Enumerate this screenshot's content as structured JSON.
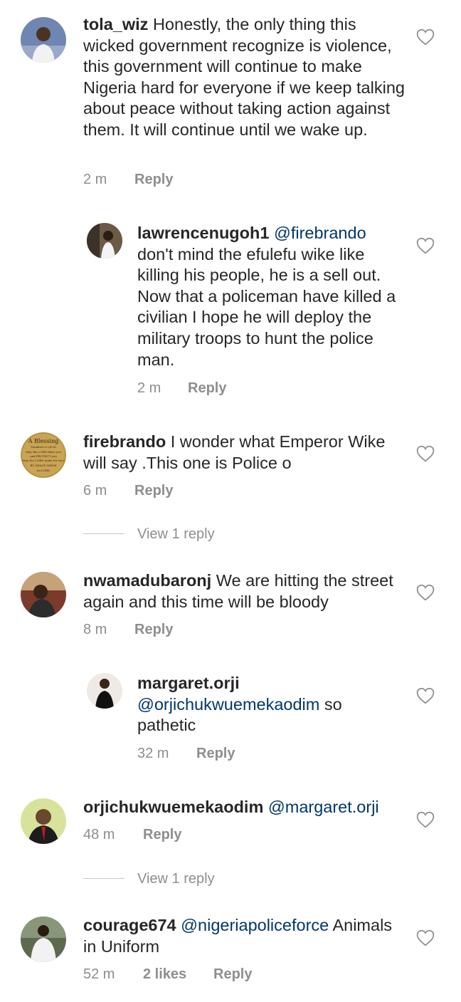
{
  "comments": [
    {
      "user": "tola_wiz",
      "text": "Honestly, the only thing this wicked government recognize is violence, this government will continue to make Nigeria hard for everyone if we keep talking about peace without taking action against them. It will continue until we wake up.",
      "time": "2 m",
      "reply_label": "Reply"
    },
    {
      "user": "lawrencenugoh1",
      "mention": "@firebrando",
      "text": "don't mind the efulefu wike like killing his people, he is a sell out. Now that a policeman have killed a civilian I hope he will deploy the military troops to hunt the police man.",
      "time": "2 m",
      "reply_label": "Reply"
    },
    {
      "user": "firebrando",
      "text": "I wonder what Emperor Wike will say .This one is Police o",
      "time": "6 m",
      "reply_label": "Reply",
      "view_replies": "View 1 reply",
      "avatar_text": [
        "A Blessing",
        "Numbers 6:24-26",
        "May the LORD bless you",
        "and PROTECT you",
        "May the LORD make his face",
        "BY GRACE SHINE",
        "on LORD"
      ]
    },
    {
      "user": "nwamadubaronj",
      "text": "We are hitting the street again and this time will be bloody",
      "time": "8 m",
      "reply_label": "Reply"
    },
    {
      "user": "margaret.orji",
      "mention": "@orjichukwuemekaodim",
      "text": "so pathetic",
      "time": "32 m",
      "reply_label": "Reply"
    },
    {
      "user": "orjichukwuemekaodim",
      "mention": "@margaret.orji",
      "text": "",
      "time": "48 m",
      "reply_label": "Reply",
      "view_replies": "View 1 reply"
    },
    {
      "user": "courage674",
      "mention": "@nigeriapoliceforce",
      "text": "Animals in Uniform",
      "time": "52 m",
      "likes": "2 likes",
      "reply_label": "Reply"
    }
  ],
  "icons": {
    "like": "heart-outline-icon"
  },
  "colors": {
    "text": "#262626",
    "meta": "#8e8e8e",
    "mention": "#00376b"
  }
}
